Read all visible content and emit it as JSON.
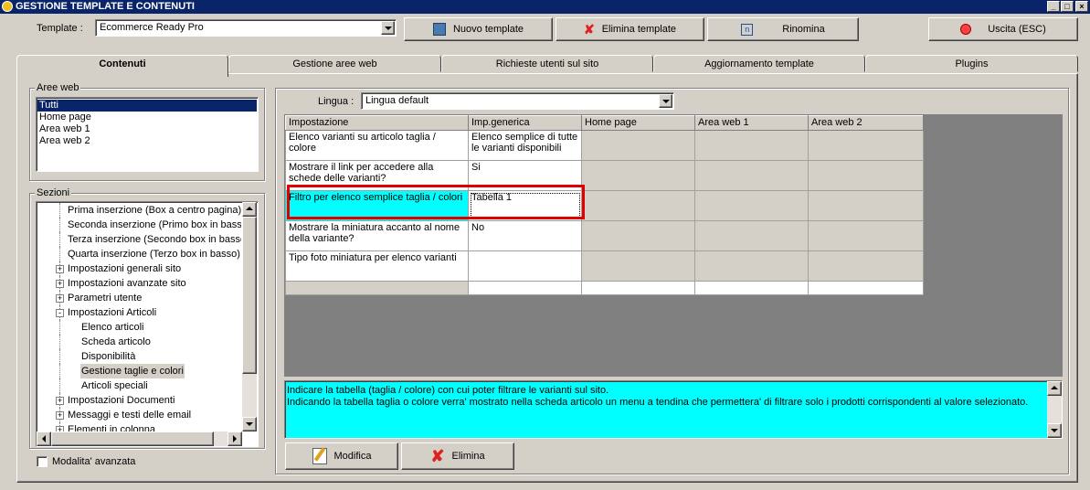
{
  "window": {
    "title": "GESTIONE TEMPLATE E CONTENUTI"
  },
  "toolbar": {
    "template_label": "Template :",
    "template_value": "Ecommerce Ready Pro",
    "new_label": "Nuovo template",
    "delete_label": "Elimina template",
    "rename_label": "Rinomina",
    "exit_label": "Uscita (ESC)"
  },
  "tabs": [
    "Contenuti",
    "Gestione aree web",
    "Richieste utenti sul sito",
    "Aggiornamento template",
    "Plugins"
  ],
  "aree_web": {
    "label": "Aree web",
    "items": [
      "Tutti",
      "Home page",
      "Area web 1",
      "Area web 2"
    ],
    "selected": "Tutti"
  },
  "sezioni": {
    "label": "Sezioni",
    "items": [
      {
        "label": "Prima inserzione (Box a centro pagina)",
        "level": 1,
        "expander": "",
        "selected": false
      },
      {
        "label": "Seconda inserzione (Primo box in basso)",
        "level": 1,
        "expander": "",
        "selected": false
      },
      {
        "label": "Terza inserzione (Secondo box in basso)",
        "level": 1,
        "expander": "",
        "selected": false
      },
      {
        "label": "Quarta inserzione (Terzo box in basso)",
        "level": 1,
        "expander": "",
        "selected": false
      },
      {
        "label": "Impostazioni generali sito",
        "level": 0,
        "expander": "+",
        "selected": false
      },
      {
        "label": "Impostazioni avanzate sito",
        "level": 0,
        "expander": "+",
        "selected": false
      },
      {
        "label": "Parametri utente",
        "level": 0,
        "expander": "+",
        "selected": false
      },
      {
        "label": "Impostazioni Articoli",
        "level": 0,
        "expander": "-",
        "selected": false
      },
      {
        "label": "Elenco articoli",
        "level": 1,
        "expander": "",
        "selected": false
      },
      {
        "label": "Scheda articolo",
        "level": 1,
        "expander": "",
        "selected": false
      },
      {
        "label": "Disponibilità",
        "level": 1,
        "expander": "",
        "selected": false
      },
      {
        "label": "Gestione taglie e colori",
        "level": 1,
        "expander": "",
        "selected": true
      },
      {
        "label": "Articoli speciali",
        "level": 1,
        "expander": "",
        "selected": false
      },
      {
        "label": "Impostazioni Documenti",
        "level": 0,
        "expander": "+",
        "selected": false
      },
      {
        "label": "Messaggi e testi delle email",
        "level": 0,
        "expander": "+",
        "selected": false
      },
      {
        "label": "Elementi in colonna",
        "level": 0,
        "expander": "+",
        "selected": false
      }
    ],
    "advanced_label": "Modalita' avanzata"
  },
  "lingua": {
    "label": "Lingua :",
    "value": "Lingua default"
  },
  "grid": {
    "headers": [
      "Impostazione",
      "Imp.generica",
      "Home page",
      "Area web 1",
      "Area web 2"
    ],
    "rows": [
      {
        "setting": "Elenco varianti su articolo taglia / colore",
        "generic": "Elenco semplice di tutte le varianti disponibili",
        "highlight": false
      },
      {
        "setting": "Mostrare il link per accedere alla schede delle varianti?",
        "generic": "Si",
        "highlight": false
      },
      {
        "setting": "Filtro per elenco semplice taglia / colori",
        "generic": "Tabella 1",
        "highlight": true
      },
      {
        "setting": "Mostrare la miniatura accanto al nome della variante?",
        "generic": "No",
        "highlight": false
      },
      {
        "setting": "Tipo foto miniatura per elenco varianti",
        "generic": "",
        "highlight": false
      }
    ]
  },
  "description": {
    "line1": "Indicare la tabella (taglia / colore) con cui poter filtrare le varianti sul sito.",
    "line2": "Indicando la tabella taglia o colore verra' mostrato nella scheda articolo un menu a tendina che permettera' di filtrare solo i prodotti corrispondenti al valore selezionato."
  },
  "actions": {
    "modify_label": "Modifica",
    "delete_label": "Elimina"
  },
  "colors": {
    "highlight": "#00ffff",
    "selection": "#0a246a",
    "focus_border": "#e00000"
  }
}
